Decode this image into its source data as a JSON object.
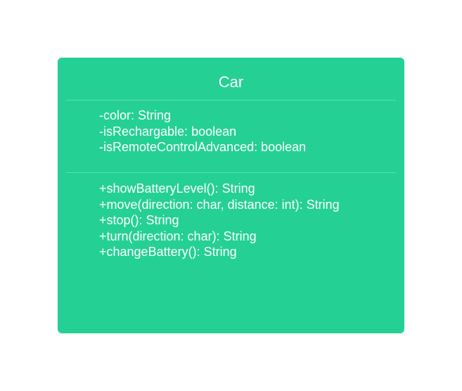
{
  "class": {
    "name": "Car",
    "fill_color": "#25d095",
    "text_color": "#ffffff",
    "attributes": [
      "-color: String",
      "-isRechargable: boolean",
      "-isRemoteControlAdvanced: boolean"
    ],
    "methods": [
      "+showBatteryLevel(): String",
      "+move(direction: char, distance: int): String",
      "+stop(): String",
      "+turn(direction: char): String",
      "+changeBattery(): String"
    ]
  }
}
